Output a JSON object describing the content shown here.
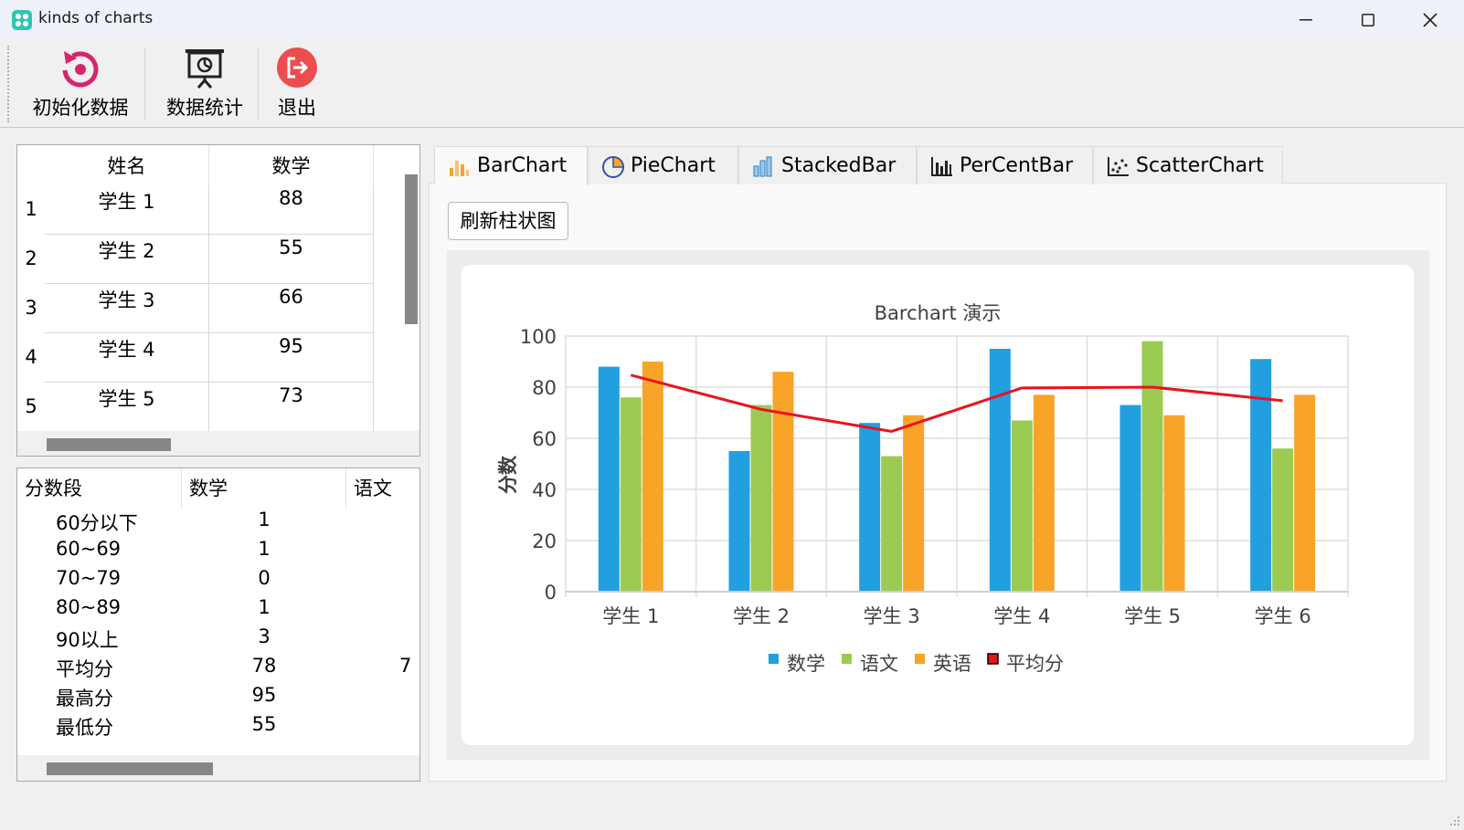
{
  "window": {
    "title": "kinds of charts"
  },
  "toolbar": {
    "init_label": "初始化数据",
    "stats_label": "数据统计",
    "exit_label": "退出"
  },
  "score_table": {
    "headers": [
      "姓名",
      "数学"
    ],
    "rows": [
      {
        "num": "1",
        "name": "学生 1",
        "math": "88"
      },
      {
        "num": "2",
        "name": "学生 2",
        "math": "55"
      },
      {
        "num": "3",
        "name": "学生 3",
        "math": "66"
      },
      {
        "num": "4",
        "name": "学生 4",
        "math": "95"
      },
      {
        "num": "5",
        "name": "学生 5",
        "math": "73"
      }
    ]
  },
  "stats_table": {
    "headers": [
      "分数段",
      "数学",
      "语文"
    ],
    "rows": [
      {
        "label": "60分以下",
        "math": "1"
      },
      {
        "label": "60~69",
        "math": "1"
      },
      {
        "label": "70~79",
        "math": "0"
      },
      {
        "label": "80~89",
        "math": "1"
      },
      {
        "label": "90以上",
        "math": "3"
      },
      {
        "label": "平均分",
        "math": "78",
        "chinese": "7"
      },
      {
        "label": "最高分",
        "math": "95"
      },
      {
        "label": "最低分",
        "math": "55"
      }
    ]
  },
  "tabs": [
    "BarChart",
    "PieChart",
    "StackedBar",
    "PerCentBar",
    "ScatterChart"
  ],
  "active_tab": "BarChart",
  "refresh_button": "刷新柱状图",
  "colors": {
    "math": "#229fdf",
    "chinese": "#9bcb53",
    "english": "#f7a428",
    "average": "#e8141c"
  },
  "chart_data": {
    "type": "bar",
    "title": "Barchart 演示",
    "ylabel": "分数",
    "xlabel": "",
    "ylim": [
      0,
      100
    ],
    "yticks": [
      0,
      20,
      40,
      60,
      80,
      100
    ],
    "grid": true,
    "legend": "bottom",
    "categories": [
      "学生 1",
      "学生 2",
      "学生 3",
      "学生 4",
      "学生 5",
      "学生 6"
    ],
    "series": [
      {
        "name": "数学",
        "values": [
          88,
          55,
          66,
          95,
          73,
          91
        ]
      },
      {
        "name": "语文",
        "values": [
          76,
          73,
          53,
          67,
          98,
          56
        ]
      },
      {
        "name": "英语",
        "values": [
          90,
          86,
          69,
          77,
          69,
          77
        ]
      }
    ],
    "line_series": {
      "name": "平均分",
      "values": [
        84.7,
        71.3,
        62.7,
        79.7,
        80.0,
        74.7
      ]
    }
  }
}
